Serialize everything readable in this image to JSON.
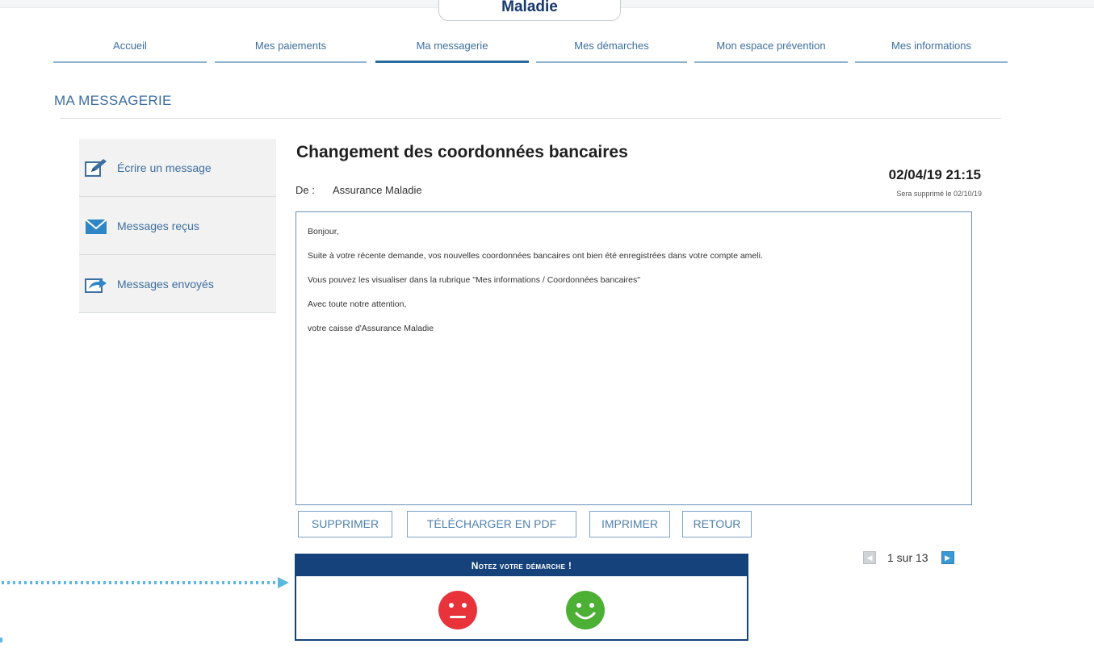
{
  "brand": {
    "text": "Maladie"
  },
  "nav": {
    "items": [
      {
        "label": "Accueil"
      },
      {
        "label": "Mes paiements"
      },
      {
        "label": "Ma messagerie",
        "active": true
      },
      {
        "label": "Mes démarches"
      },
      {
        "label": "Mon espace prévention"
      },
      {
        "label": "Mes informations"
      }
    ]
  },
  "section": {
    "title": "MA MESSAGERIE"
  },
  "sidebar": {
    "items": [
      {
        "label": "Écrire un message",
        "icon": "pencil-icon"
      },
      {
        "label": "Messages reçus",
        "icon": "envelope-icon"
      },
      {
        "label": "Messages envoyés",
        "icon": "send-icon"
      }
    ]
  },
  "message": {
    "title": "Changement des coordonnées bancaires",
    "from_label": "De :",
    "from": "Assurance Maladie",
    "date": "02/04/19 21:15",
    "delete_notice": "Sera supprimé le 02/10/19",
    "body": [
      "Bonjour,",
      "Suite à votre récente demande, vos nouvelles coordonnées bancaires ont bien été enregistrées dans votre compte ameli.",
      "Vous pouvez les visualiser dans la rubrique \"Mes informations / Coordonnées bancaires\"",
      "Avec toute notre attention,",
      "votre caisse d'Assurance Maladie"
    ]
  },
  "actions": {
    "delete": "SUPPRIMER",
    "pdf": "TÉLÉCHARGER EN PDF",
    "print": "IMPRIMER",
    "back": "RETOUR"
  },
  "pager": {
    "text": "1 sur 13"
  },
  "rating": {
    "title": "Notez votre démarche !",
    "negative_color": "#e8333b",
    "positive_color": "#4cb034"
  },
  "colors": {
    "accent": "#3c6e9e",
    "navy": "#15427a",
    "arrow": "#5bb8e0"
  }
}
